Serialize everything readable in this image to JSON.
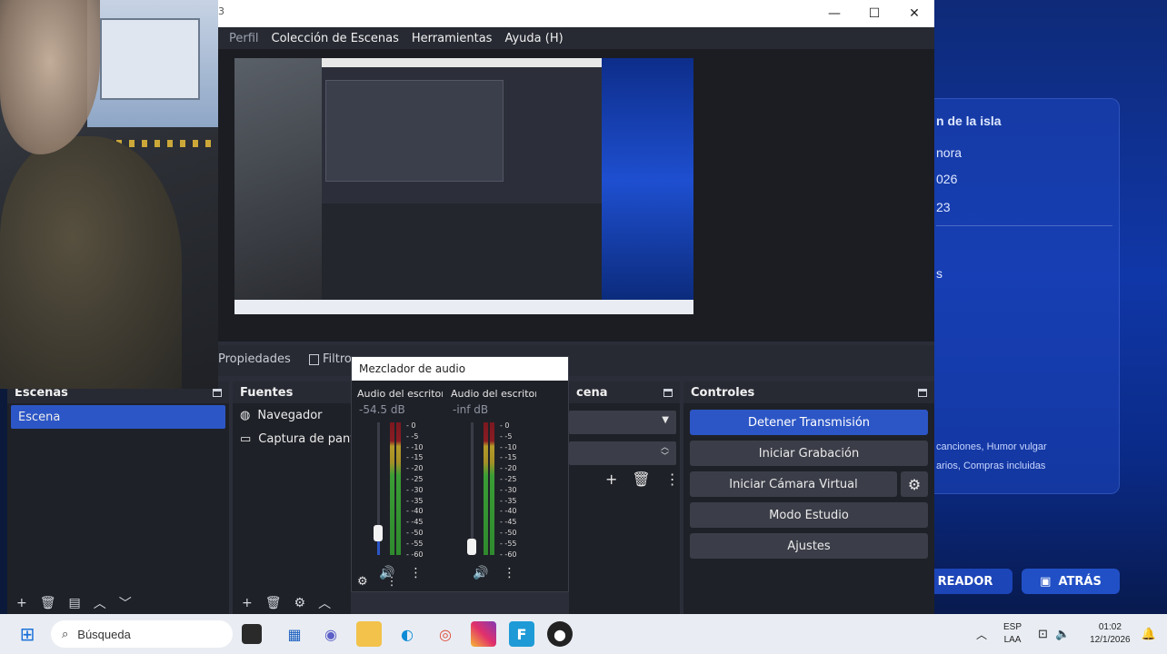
{
  "background_page": {
    "lines": [
      "n de la isla",
      "nora",
      "026",
      "23",
      "s"
    ],
    "small_lines": [
      "canciones, Humor vulgar",
      "arios, Compras incluidas"
    ],
    "btn_creator": "READOR",
    "btn_back": "ATRÁS"
  },
  "obs": {
    "title_mark": "3",
    "menu": [
      "Perfil",
      "Colección de Escenas",
      "Herramientas",
      "Ayuda (H)"
    ],
    "dock_tabs": {
      "properties": "Propiedades",
      "filters": "Filtro"
    },
    "scenes": {
      "title": "Escenas",
      "items": [
        "Escena"
      ]
    },
    "sources": {
      "title": "Fuentes",
      "items": [
        "Navegador",
        "Captura de pantal"
      ]
    },
    "transitions": {
      "title": "cena"
    },
    "controls": {
      "title": "Controles",
      "stop_stream": "Detener Transmisión",
      "start_recording": "Iniciar Grabación",
      "start_virtual_cam": "Iniciar Cámara Virtual",
      "studio_mode": "Modo Estudio",
      "settings": "Ajustes"
    },
    "mixer": {
      "title": "Mezclador de audio",
      "channels": [
        {
          "name": "Audio del escritorio",
          "db": "-54.5 dB",
          "level": 0.12
        },
        {
          "name": "Audio del escritorio",
          "db": "-inf dB",
          "level": 0.0
        }
      ],
      "scale": [
        "0",
        "-5",
        "-10",
        "-15",
        "-20",
        "-25",
        "-30",
        "-35",
        "-40",
        "-45",
        "-50",
        "-55",
        "-60"
      ]
    }
  },
  "taskbar": {
    "search_placeholder": "Búsqueda",
    "lang_top": "ESP",
    "lang_bottom": "LAA",
    "time": "01:02",
    "date": "12/1/2026"
  }
}
